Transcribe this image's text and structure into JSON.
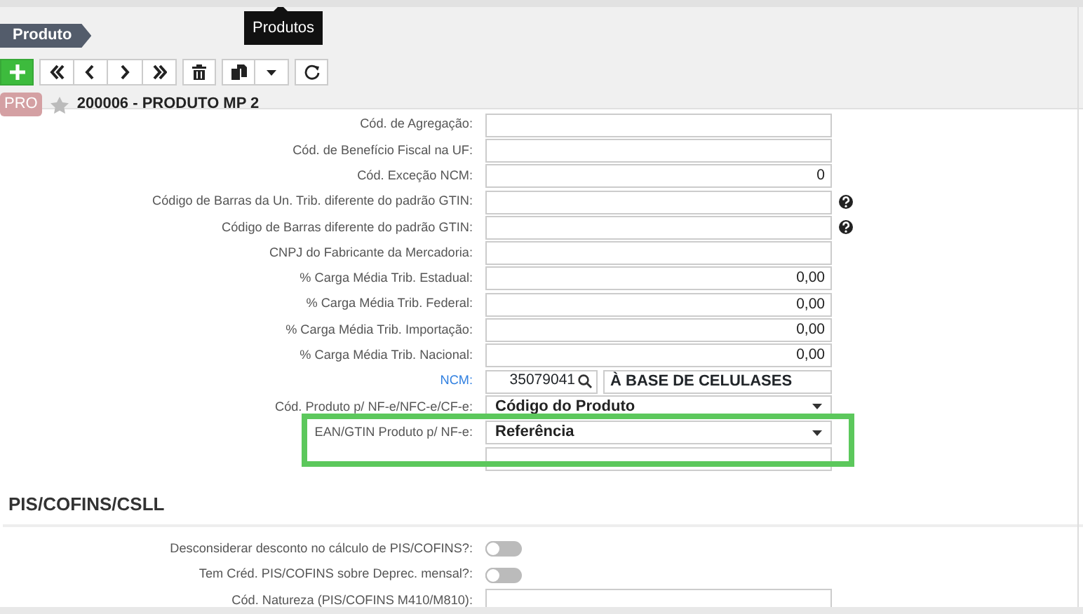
{
  "breadcrumb": "Produto",
  "tooltip": "Produtos",
  "record": {
    "badge": "PRO",
    "starred": false,
    "title": "200006 - PRODUTO MP 2"
  },
  "fields": [
    {
      "label": "Cód. de Agregação:",
      "kind": "text"
    },
    {
      "label": "Cód. de Benefício Fiscal na UF:",
      "kind": "text"
    },
    {
      "label": "Cód. Exceção NCM:",
      "kind": "text",
      "value": "0"
    },
    {
      "label": "Código de Barras da Un. Trib. diferente do padrão GTIN:",
      "kind": "text",
      "help": true
    },
    {
      "label": "Código de Barras diferente do padrão GTIN:",
      "kind": "text",
      "help": true
    },
    {
      "label": "CNPJ do Fabricante da Mercadoria:",
      "kind": "text"
    },
    {
      "label": "% Carga Média Trib. Estadual:",
      "kind": "text",
      "value": "0,00"
    },
    {
      "label": "% Carga Média Trib. Federal:",
      "kind": "text",
      "value": "0,00"
    },
    {
      "label": "% Carga Média Trib. Importação:",
      "kind": "text",
      "value": "0,00"
    },
    {
      "label": "% Carga Média Trib. Nacional:",
      "kind": "text",
      "value": "0,00"
    },
    {
      "label": "NCM:",
      "kind": "lookup",
      "link": true,
      "value": "35079041",
      "description": "À BASE DE CELULASES"
    },
    {
      "label": "Cód. Produto p/ NF-e/NFC-e/CF-e:",
      "kind": "select",
      "value": "Código do Produto"
    },
    {
      "label": "EAN/GTIN Produto p/ NF-e:",
      "kind": "select",
      "value": "Referência",
      "highlighted": true
    },
    {
      "kind": "text"
    }
  ],
  "section": {
    "title": "PIS/COFINS/CSLL",
    "fields": [
      {
        "label": "Desconsiderar desconto no cálculo de PIS/COFINS?:",
        "kind": "toggle",
        "on": false
      },
      {
        "label": "Tem Créd. PIS/COFINS sobre Deprec. mensal?:",
        "kind": "toggle",
        "on": false
      },
      {
        "label": "Cód. Natureza (PIS/COFINS M410/M810):",
        "kind": "text"
      }
    ]
  }
}
